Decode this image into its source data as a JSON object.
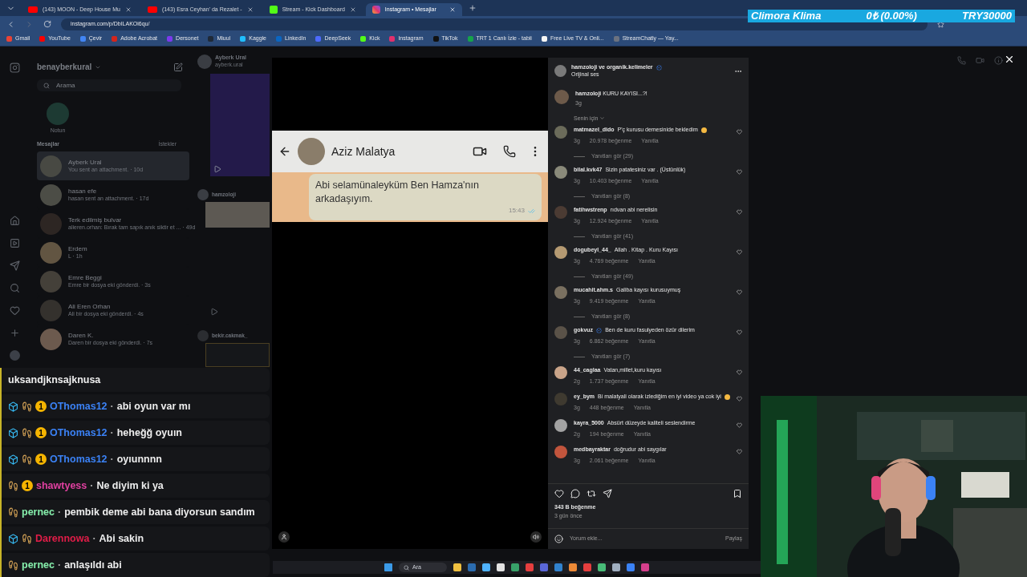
{
  "browser": {
    "tabs": [
      {
        "title": "(143) MOON - Deep House Mu",
        "kind": "youtube",
        "selected": false
      },
      {
        "title": "(143) Esra Ceyhan' da Rezalet -",
        "kind": "youtube",
        "selected": false
      },
      {
        "title": "Stream - Kick Dashboard",
        "kind": "kick",
        "selected": false
      },
      {
        "title": "Instagram • Mesajlar",
        "kind": "instagram",
        "selected": true
      }
    ],
    "address": "instagram.com/p/DbILAKOi6qu/",
    "bookmarks": [
      {
        "label": "Gmail",
        "color": "#ea4335"
      },
      {
        "label": "YouTube",
        "color": "#ff0000"
      },
      {
        "label": "Çevir",
        "color": "#4285f4"
      },
      {
        "label": "Adobe Acrobat",
        "color": "#d4251c"
      },
      {
        "label": "Dersonet",
        "color": "#7c3aed"
      },
      {
        "label": "Miuul",
        "color": "#1f2937"
      },
      {
        "label": "Kaggle",
        "color": "#20beff"
      },
      {
        "label": "LinkedIn",
        "color": "#0a66c2"
      },
      {
        "label": "DeepSeek",
        "color": "#4d6bfe"
      },
      {
        "label": "Kick",
        "color": "#53fc18"
      },
      {
        "label": "Instagram",
        "color": "#e1306c"
      },
      {
        "label": "TikTok",
        "color": "#111111"
      },
      {
        "label": "TRT 1 Canlı İzle - tabii",
        "color": "#16a34a"
      },
      {
        "label": "Free Live TV & Onli...",
        "color": "#f5f5f5"
      },
      {
        "label": "StreamChatly — Yay...",
        "color": "#6b7280"
      }
    ]
  },
  "ticker": {
    "name": "Climora Klima",
    "change": "0₺ (0.00%)",
    "price": "TRY30000"
  },
  "sidebar": {
    "username": "benayberkural",
    "search": {
      "placeholder": "Arama"
    },
    "note": {
      "label": "Notun"
    },
    "section": "Mesajlar",
    "requests": "İstekler",
    "conversations": [
      {
        "name": "Ayberk Ural",
        "preview": "You sent an attachment. · 10d",
        "selected": true
      },
      {
        "name": "hasan efe",
        "preview": "hasan sent an attachment. · 17d",
        "selected": false
      },
      {
        "name": "Terk edilmiş bulvar",
        "preview": "alieren.orhan: Bırak tam sapık anık siktir et ... · 49d",
        "selected": false
      },
      {
        "name": "Erdem",
        "preview": "L · 1h",
        "selected": false
      },
      {
        "name": "Emre Beggi",
        "preview": "Emre bir dosya eki gönderdi. · 3s",
        "selected": false
      },
      {
        "name": "Ali Eren Orhan",
        "preview": "Ali bir dosya eki gönderdi. · 4s",
        "selected": false
      },
      {
        "name": "Daren K.",
        "preview": "Daren bir dosya eki gönderdi. · 7s",
        "selected": false
      }
    ]
  },
  "thread": {
    "name": "Ayberk Ural",
    "handle": "ayberk.ural",
    "senders": [
      "hamzoloji",
      "bekir.cakmak_"
    ]
  },
  "video": {
    "contact": "Aziz Malatya",
    "message": "Abi selamünaleyküm Ben Hamza'nın arkadaşıyım.",
    "time": "15:43"
  },
  "post": {
    "author": "hamzoloji ve organik.kelimeler",
    "author_verified": true,
    "audio": "Orijinal ses",
    "caption_user": "hamzoloji",
    "caption": "KURU KAYISI...?!",
    "caption_time": "3g",
    "filter": "Senin için",
    "comments": [
      {
        "user": "matmazel_dido",
        "verified": false,
        "text": "P'ç kurusu demesinide bekledim",
        "emoji": true,
        "time": "3g",
        "likes": "20.978 beğenme",
        "reply": "Yanıtla",
        "replies": "Yanıtları gör (29)"
      },
      {
        "user": "bilal.kvk47",
        "verified": false,
        "text": "Sizin patatesiniz var . (Üstünlük)",
        "emoji": false,
        "time": "3g",
        "likes": "10.403 beğenme",
        "reply": "Yanıtla",
        "replies": "Yanıtları gör (8)"
      },
      {
        "user": "fatihwstrenp",
        "verified": false,
        "text": "rıdvan abi nerelisin",
        "emoji": false,
        "time": "3g",
        "likes": "12.924 beğenme",
        "reply": "Yanıtla",
        "replies": "Yanıtları gör (41)"
      },
      {
        "user": "dogubeyl_44_",
        "verified": false,
        "text": "Allah . Kitap . Kuru Kayısı",
        "emoji": false,
        "time": "3g",
        "likes": "4.769 beğenme",
        "reply": "Yanıtla",
        "replies": "Yanıtları gör (49)"
      },
      {
        "user": "mucahit.ahm.s",
        "verified": false,
        "text": "Galiba kayısı kurusuymuş",
        "emoji": false,
        "time": "3g",
        "likes": "9.419 beğenme",
        "reply": "Yanıtla",
        "replies": "Yanıtları gör (8)"
      },
      {
        "user": "gokvuz",
        "verified": true,
        "text": "Ben de kuru fasulyeden özür dilerim",
        "emoji": false,
        "time": "3g",
        "likes": "6.862 beğenme",
        "reply": "Yanıtla",
        "replies": "Yanıtları gör (7)"
      },
      {
        "user": "44_caglaa",
        "verified": false,
        "text": "Vatan,millet,kuru kayısı",
        "emoji": false,
        "time": "2g",
        "likes": "1.737 beğenme",
        "reply": "Yanıtla"
      },
      {
        "user": "ey_bym",
        "verified": false,
        "text": "Bi malatyali olarak izlediğim en iyi video ya cok iyi",
        "emoji": true,
        "time": "3g",
        "likes": "448 beğenme",
        "reply": "Yanıtla"
      },
      {
        "user": "kayra_5000",
        "verified": false,
        "text": "Absürt düzeyde kaliteli seslendirme",
        "emoji": false,
        "time": "2g",
        "likes": "194 beğenme",
        "reply": "Yanıtla"
      },
      {
        "user": "medbayraktar",
        "verified": false,
        "text": "doğrudur abi saygılar",
        "emoji": false,
        "time": "3g",
        "likes": "2.061 beğenme",
        "reply": "Yanıtla"
      }
    ],
    "likes": "343 B beğenme",
    "posted": "3 gün önce",
    "comment_box": {
      "placeholder": "Yorum ekle..."
    },
    "share": "Paylaş"
  },
  "chat": [
    {
      "text": "uksandjknsajknusa"
    },
    {
      "user": "OThomas12",
      "color": "#3b82f6",
      "separator": "·",
      "text": "abi oyun var mı",
      "badges": [
        {
          "kind": "cube"
        },
        {
          "kind": "boot"
        },
        {
          "kind": "coin",
          "label": "1"
        }
      ]
    },
    {
      "user": "OThomas12",
      "color": "#3b82f6",
      "separator": "·",
      "text": "heheğğ oyuın",
      "badges": [
        {
          "kind": "cube"
        },
        {
          "kind": "boot"
        },
        {
          "kind": "coin",
          "label": "1"
        }
      ]
    },
    {
      "user": "OThomas12",
      "color": "#3b82f6",
      "separator": "·",
      "text": "oyıunnnn",
      "badges": [
        {
          "kind": "cube"
        },
        {
          "kind": "boot"
        },
        {
          "kind": "coin",
          "label": "1"
        }
      ]
    },
    {
      "user": "shawtyess",
      "color": "#e040a0",
      "separator": "·",
      "text": "Ne diyim ki ya",
      "badges": [
        {
          "kind": "boot"
        },
        {
          "kind": "coin",
          "label": "1"
        }
      ]
    },
    {
      "user": "pernec",
      "color": "#86efac",
      "separator": "·",
      "text": "pembik deme abi bana diyorsun sandım",
      "badges": [
        {
          "kind": "boot"
        }
      ]
    },
    {
      "user": "Darennowa",
      "color": "#e11d48",
      "separator": "·",
      "text": "Abi sakin",
      "badges": [
        {
          "kind": "cube"
        },
        {
          "kind": "boot"
        }
      ]
    },
    {
      "user": "pernec",
      "color": "#86efac",
      "separator": "·",
      "text": "anlaşıldı abi",
      "badges": [
        {
          "kind": "boot"
        }
      ]
    }
  ],
  "taskbar": {
    "search": {
      "placeholder": "Ara"
    }
  }
}
